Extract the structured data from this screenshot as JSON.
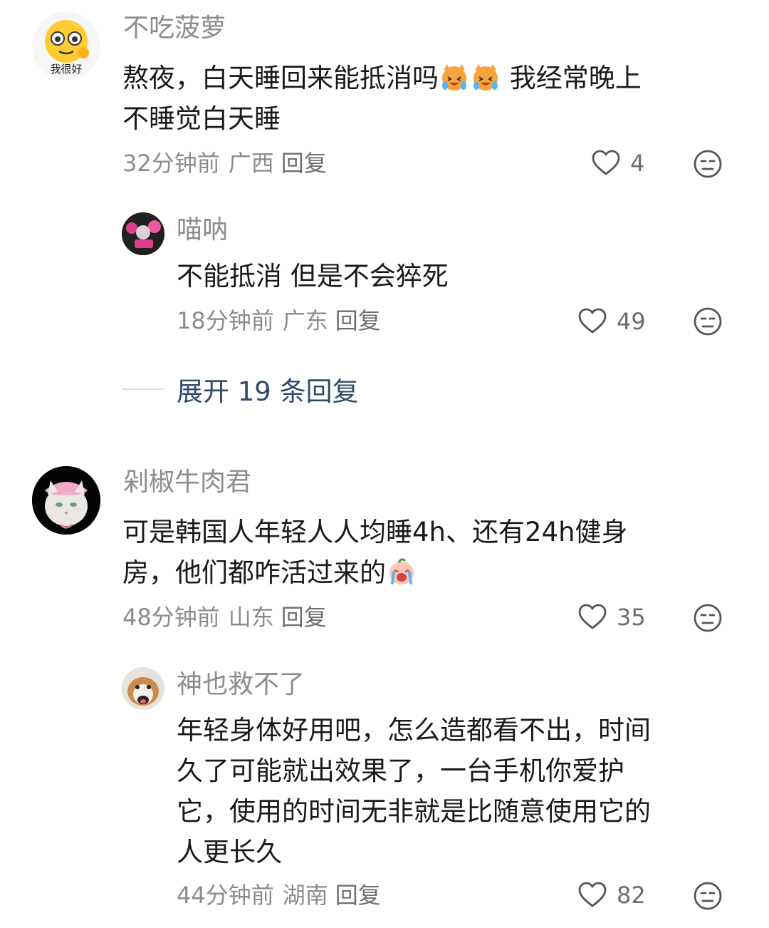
{
  "comments": [
    {
      "avatar": "yellow-emoji-avatar",
      "avatar_text": "我很好",
      "username": "不吃菠萝",
      "text_part1": "熬夜，白天睡回来能抵消吗",
      "text_part2": " 我经常晚上",
      "text_line2": "不睡觉白天睡",
      "time": "32分钟前",
      "location": "广西",
      "reply": "回复",
      "likes": "4"
    },
    {
      "avatar": "pink-scene-avatar",
      "username": "喵呐",
      "text": "不能抵消 但是不会猝死",
      "time": "18分钟前",
      "location": "广东",
      "reply": "回复",
      "likes": "49"
    },
    {
      "avatar": "white-cat-avatar",
      "username": "剁椒牛肉君",
      "text_line1": "可是韩国人年轻人人均睡4h、还有24h健身",
      "text_line2": "房，他们都咋活过来的",
      "time": "48分钟前",
      "location": "山东",
      "reply": "回复",
      "likes": "35"
    },
    {
      "avatar": "dog-avatar",
      "username": "神也救不了",
      "text_line1": "年轻身体好用吧，怎么造都看不出，时间",
      "text_line2": "久了可能就出效果了，一台手机你爱护",
      "text_line3": "它，使用的时间无非就是比随意使用它的",
      "text_line4": "人更长久",
      "time": "44分钟前",
      "location": "湖南",
      "reply": "回复",
      "likes": "82"
    }
  ],
  "expand_replies": "展开 19 条回复",
  "colors": {
    "meta": "#8c8c8c",
    "expand_link": "#2f4a6d",
    "text": "#1a1a1a"
  }
}
